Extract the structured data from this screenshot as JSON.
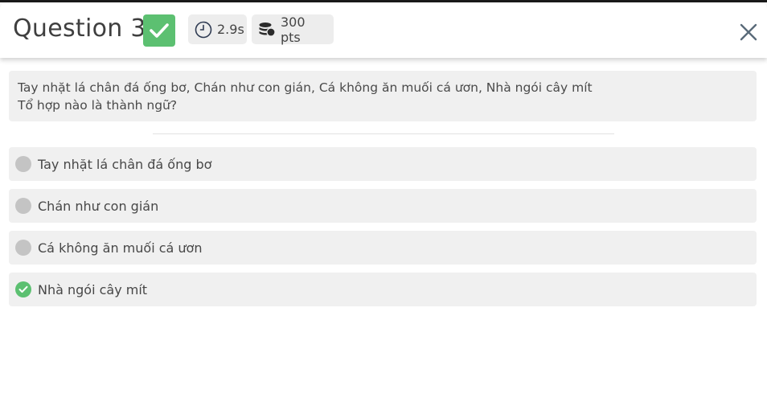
{
  "header": {
    "title": "Question 3",
    "status_icon": "check-icon",
    "time": "2.9s",
    "time_icon": "clock-icon",
    "points": "300 pts",
    "points_icon": "coins-icon",
    "close_icon": "close-icon"
  },
  "question": {
    "line1": "Tay nhặt lá chân đá ống bơ, Chán như con gián, Cá không ăn muối cá ươn, Nhà ngói cây mít",
    "line2": "Tổ hợp nào là thành ngữ?"
  },
  "options": [
    {
      "label": "Tay nhặt lá chân đá ống bơ",
      "state": "unselected"
    },
    {
      "label": "Chán như con gián",
      "state": "unselected"
    },
    {
      "label": "Cá không ăn muối cá ươn",
      "state": "unselected"
    },
    {
      "label": "Nhà ngói cây mít",
      "state": "correct"
    }
  ],
  "colors": {
    "correct": "#5cc071",
    "option_bg": "#f0f0f0",
    "radio_idle": "#c4c4c4",
    "close_icon": "#5a6b7a"
  }
}
